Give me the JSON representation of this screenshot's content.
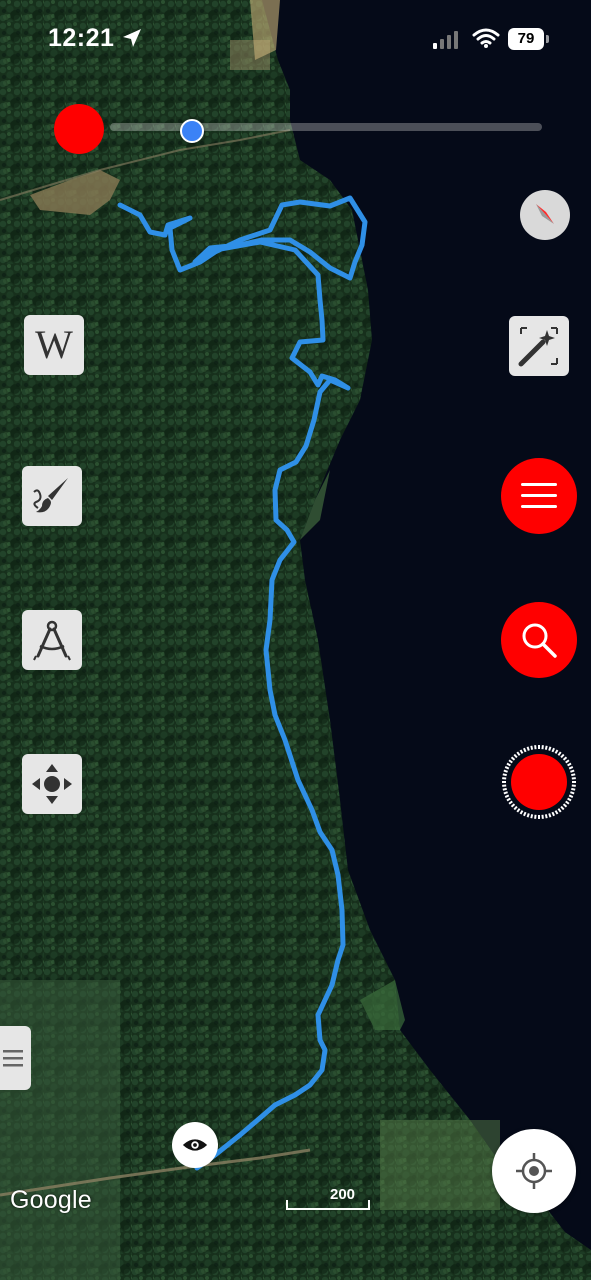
{
  "status_bar": {
    "time": "12:21",
    "battery_level": "79",
    "icons": [
      "location-arrow-icon",
      "cellular-signal-icon",
      "wifi-icon",
      "battery-icon"
    ]
  },
  "map": {
    "type": "satellite",
    "attribution": "Google",
    "scale_label": "200",
    "track_color": "#2f8fe6",
    "water_color": "#050a18"
  },
  "timeline_slider": {
    "position": 0.19
  },
  "left_toolbar": {
    "items": [
      {
        "name": "wikipedia-button",
        "icon": "wikipedia-icon",
        "glyph": "W"
      },
      {
        "name": "draw-button",
        "icon": "paintbrush-icon"
      },
      {
        "name": "measure-button",
        "icon": "compass-drafting-icon"
      },
      {
        "name": "move-button",
        "icon": "move-arrows-icon"
      }
    ]
  },
  "right_toolbar": {
    "items": [
      {
        "name": "north-compass",
        "icon": "compass-needle-icon"
      },
      {
        "name": "magic-wand-button",
        "icon": "magic-wand-icon"
      },
      {
        "name": "menu-button",
        "icon": "hamburger-menu-icon"
      },
      {
        "name": "search-button",
        "icon": "search-icon"
      },
      {
        "name": "record-button",
        "icon": "record-dot-icon"
      },
      {
        "name": "locate-me-button",
        "icon": "crosshair-location-icon"
      }
    ]
  },
  "colors": {
    "accent_red": "#ff0000",
    "tool_bg": "#e6e6e6",
    "slider_thumb": "#3b82f6"
  }
}
